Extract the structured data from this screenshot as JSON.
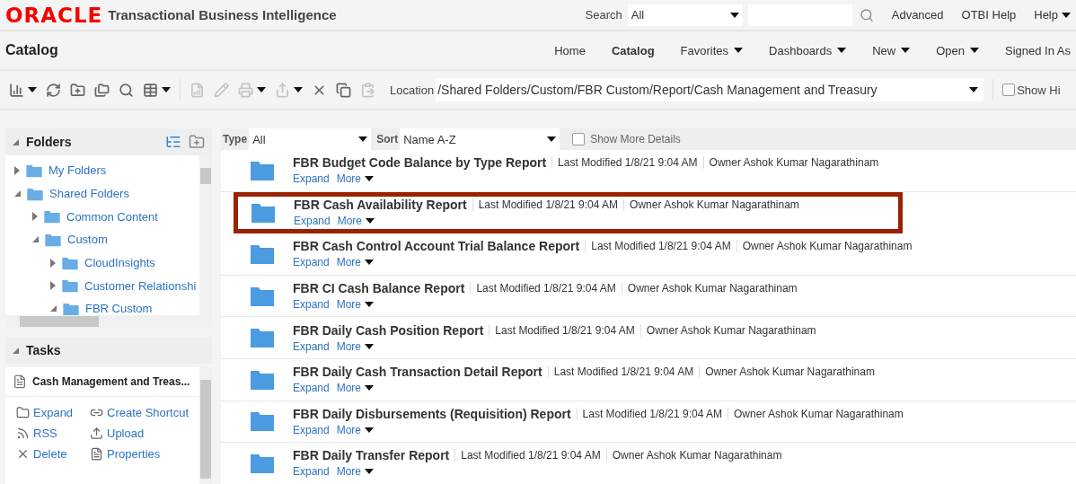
{
  "header": {
    "logo": "ORACLE",
    "product": "Transactional Business Intelligence",
    "search_label": "Search",
    "search_scope": "All",
    "links": [
      {
        "label": "Advanced",
        "menu": false
      },
      {
        "label": "OTBI Help",
        "menu": false
      },
      {
        "label": "Help",
        "menu": true
      }
    ]
  },
  "nav": {
    "title": "Catalog",
    "items": [
      {
        "label": "Home",
        "selected": false,
        "menu": false
      },
      {
        "label": "Catalog",
        "selected": true,
        "menu": false
      },
      {
        "label": "Favorites",
        "selected": false,
        "menu": true
      },
      {
        "label": "Dashboards",
        "selected": false,
        "menu": true
      },
      {
        "label": "New",
        "selected": false,
        "menu": true
      },
      {
        "label": "Open",
        "selected": false,
        "menu": true
      },
      {
        "label": "Signed In As",
        "selected": false,
        "menu": false
      }
    ]
  },
  "toolbar": {
    "tools": [
      {
        "kind": "view",
        "disabled": false,
        "menu": true
      },
      {
        "kind": "refresh",
        "disabled": false,
        "menu": false
      },
      {
        "kind": "new-folder",
        "disabled": false,
        "menu": false
      },
      {
        "kind": "folders",
        "disabled": false,
        "menu": false
      },
      {
        "kind": "search",
        "disabled": false,
        "menu": false
      },
      {
        "kind": "table",
        "disabled": false,
        "menu": true
      },
      {
        "kind": "sep"
      },
      {
        "kind": "report",
        "disabled": true,
        "menu": false
      },
      {
        "kind": "edit",
        "disabled": true,
        "menu": false
      },
      {
        "kind": "print",
        "disabled": true,
        "menu": true
      },
      {
        "kind": "export",
        "disabled": true,
        "menu": true
      },
      {
        "kind": "delete",
        "disabled": false,
        "menu": false
      },
      {
        "kind": "copy",
        "disabled": false,
        "menu": false
      },
      {
        "kind": "paste",
        "disabled": true,
        "menu": false
      }
    ],
    "location_label": "Location",
    "location": "/Shared Folders/Custom/FBR Custom/Report/Cash Management and Treasury",
    "show_hidden": {
      "label": "Show Hi",
      "checked": false
    }
  },
  "folders": {
    "title": "Folders",
    "tree": [
      {
        "label": "My Folders",
        "expanded": false
      },
      {
        "label": "Shared Folders",
        "expanded": true,
        "children": [
          {
            "label": "Common Content",
            "expanded": false
          },
          {
            "label": "Custom",
            "expanded": true,
            "children": [
              {
                "label": "CloudInsights",
                "expanded": false
              },
              {
                "label": "Customer Relationshi",
                "expanded": false
              },
              {
                "label": "FBR Custom",
                "expanded": true
              }
            ]
          }
        ]
      }
    ]
  },
  "tasks": {
    "title": "Tasks",
    "item": "Cash Management and Treas...",
    "actions": [
      {
        "kind": "expand",
        "label": "Expand"
      },
      {
        "kind": "shortcut",
        "label": "Create Shortcut"
      },
      {
        "kind": "rss",
        "label": "RSS"
      },
      {
        "kind": "upload",
        "label": "Upload"
      },
      {
        "kind": "delete",
        "label": "Delete"
      },
      {
        "kind": "properties",
        "label": "Properties"
      }
    ]
  },
  "filters": {
    "type_label": "Type",
    "type": "All",
    "sort_label": "Sort",
    "sort": "Name A-Z",
    "more_details": {
      "label": "Show More Details",
      "checked": false
    }
  },
  "items": [
    {
      "name": "FBR Budget Code Balance by Type Report",
      "modified": "Last Modified 1/8/21 9:04 AM",
      "owner": "Owner Ashok Kumar Nagarathinam",
      "expand": "Expand",
      "more": "More",
      "highlighted": false
    },
    {
      "name": "FBR Cash Availability Report",
      "modified": "Last Modified 1/8/21 9:04 AM",
      "owner": "Owner Ashok Kumar Nagarathinam",
      "expand": "Expand",
      "more": "More",
      "highlighted": true
    },
    {
      "name": "FBR Cash Control Account Trial Balance Report",
      "modified": "Last Modified 1/8/21 9:04 AM",
      "owner": "Owner Ashok Kumar Nagarathinam",
      "expand": "Expand",
      "more": "More",
      "highlighted": false
    },
    {
      "name": "FBR CI Cash Balance Report",
      "modified": "Last Modified 1/8/21 9:04 AM",
      "owner": "Owner Ashok Kumar Nagarathinam",
      "expand": "Expand",
      "more": "More",
      "highlighted": false
    },
    {
      "name": "FBR Daily Cash Position Report",
      "modified": "Last Modified 1/8/21 9:04 AM",
      "owner": "Owner Ashok Kumar Nagarathinam",
      "expand": "Expand",
      "more": "More",
      "highlighted": false
    },
    {
      "name": "FBR Daily Cash Transaction Detail Report",
      "modified": "Last Modified 1/8/21 9:04 AM",
      "owner": "Owner Ashok Kumar Nagarathinam",
      "expand": "Expand",
      "more": "More",
      "highlighted": false
    },
    {
      "name": "FBR Daily Disbursements (Requisition) Report",
      "modified": "Last Modified 1/8/21 9:04 AM",
      "owner": "Owner Ashok Kumar Nagarathinam",
      "expand": "Expand",
      "more": "More",
      "highlighted": false
    },
    {
      "name": "FBR Daily Transfer Report",
      "modified": "Last Modified 1/8/21 9:04 AM",
      "owner": "Owner Ashok Kumar Nagarathinam",
      "expand": "Expand",
      "more": "More",
      "highlighted": false
    }
  ]
}
